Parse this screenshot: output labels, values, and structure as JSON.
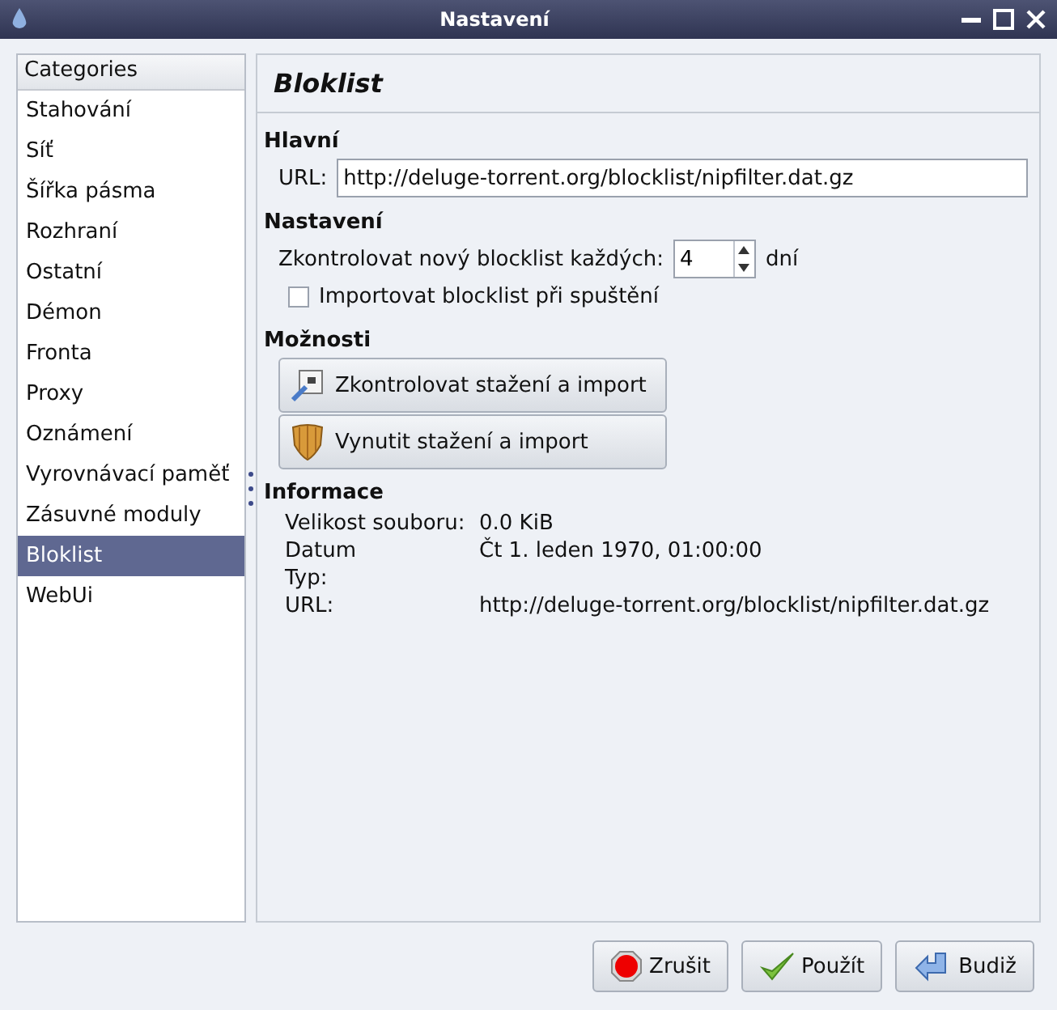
{
  "window": {
    "title": "Nastavení"
  },
  "sidebar": {
    "header": "Categories",
    "items": [
      {
        "label": "Stahování",
        "selected": false
      },
      {
        "label": "Síť",
        "selected": false
      },
      {
        "label": "Šířka pásma",
        "selected": false
      },
      {
        "label": "Rozhraní",
        "selected": false
      },
      {
        "label": "Ostatní",
        "selected": false
      },
      {
        "label": "Démon",
        "selected": false
      },
      {
        "label": "Fronta",
        "selected": false
      },
      {
        "label": "Proxy",
        "selected": false
      },
      {
        "label": "Oznámení",
        "selected": false
      },
      {
        "label": "Vyrovnávací paměť",
        "selected": false
      },
      {
        "label": "Zásuvné moduly",
        "selected": false
      },
      {
        "label": "Bloklist",
        "selected": true
      },
      {
        "label": "WebUi",
        "selected": false
      }
    ]
  },
  "page": {
    "title": "Bloklist",
    "main": {
      "heading": "Hlavní",
      "url_label": "URL:",
      "url_value": "http://deluge-torrent.org/blocklist/nipfilter.dat.gz"
    },
    "settings": {
      "heading": "Nastavení",
      "interval_label": "Zkontrolovat nový blocklist každých:",
      "interval_value": "4",
      "interval_unit": "dní",
      "import_label": "Importovat blocklist při spuštění",
      "import_checked": false
    },
    "options": {
      "heading": "Možnosti",
      "buttons": [
        {
          "kind": "check",
          "label": "Zkontrolovat stažení a import"
        },
        {
          "kind": "force",
          "label": "Vynutit stažení a import"
        }
      ]
    },
    "info": {
      "heading": "Informace",
      "rows": [
        {
          "label": "Velikost souboru:",
          "value": "0.0 KiB"
        },
        {
          "label": "Datum",
          "value": "Čt 1. leden 1970, 01:00:00"
        },
        {
          "label": "Typ:"
        },
        {
          "label": "URL:",
          "value": "http://deluge-torrent.org/blocklist/nipfilter.dat.gz"
        }
      ]
    }
  },
  "buttons": [
    {
      "kind": "cancel",
      "label": "Zrušit"
    },
    {
      "kind": "apply",
      "label": "Použít"
    },
    {
      "kind": "ok",
      "label": "Budiž"
    }
  ]
}
